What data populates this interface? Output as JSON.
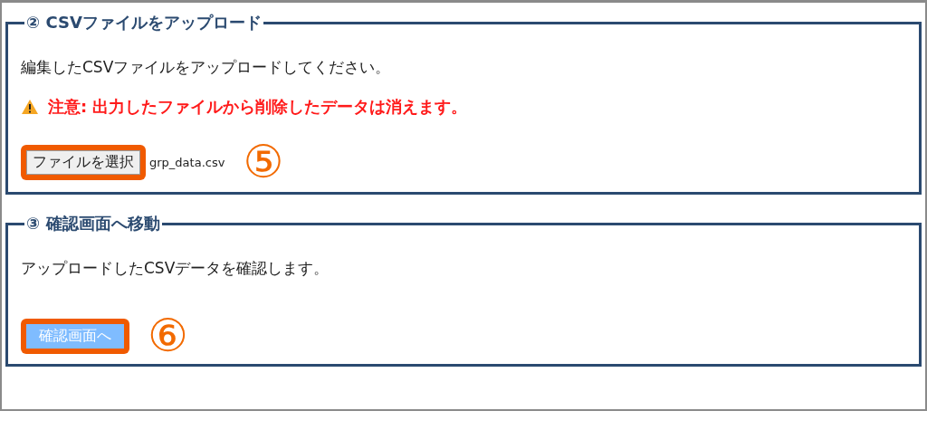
{
  "sections": [
    {
      "legend": "② CSVファイルをアップロード",
      "description": "編集したCSVファイルをアップロードしてください。",
      "warning": "注意: 出力したファイルから削除したデータは消えます。",
      "button": {
        "label": "ファイルを選択",
        "kind": "file"
      },
      "file_name": "grp_data.csv",
      "marker": "⑤"
    },
    {
      "legend": "③ 確認画面へ移動",
      "description": "アップロードしたCSVデータを確認します。",
      "button": {
        "label": "確認画面へ",
        "kind": "primary"
      },
      "marker": "⑥"
    }
  ]
}
